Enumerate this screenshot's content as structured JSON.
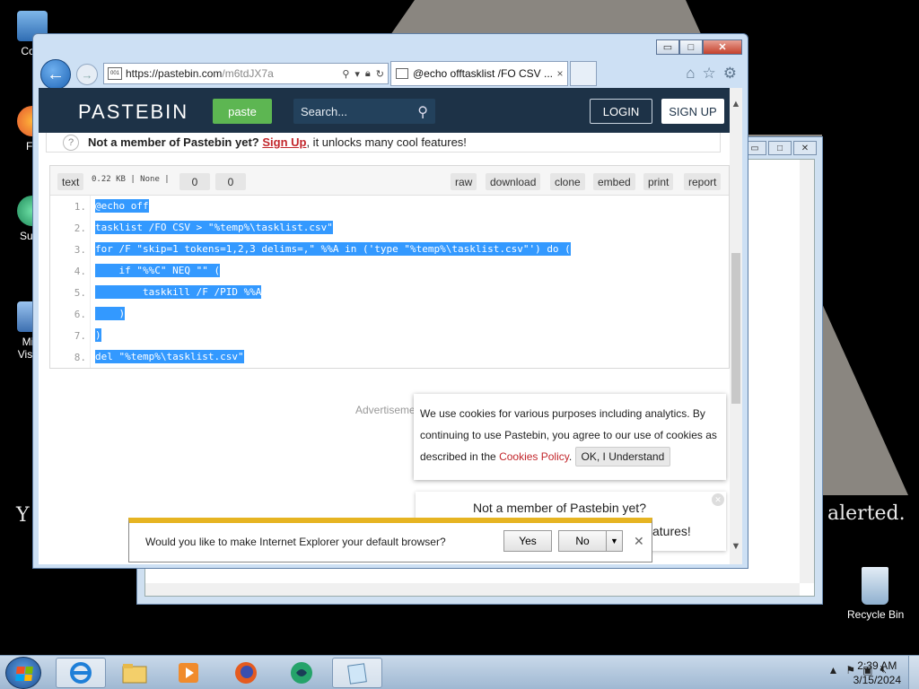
{
  "desktop": {
    "icons": [
      {
        "label": "Com",
        "icon": "computer-icon"
      },
      {
        "label": "Fir",
        "icon": "firefox-icon"
      },
      {
        "label": "Supe",
        "icon": "app-icon"
      },
      {
        "label": "Micr",
        "icon": "visual-studio-icon"
      },
      {
        "label": "Visual",
        "icon": "visual-studio-icon"
      },
      {
        "label": "Recycle Bin",
        "icon": "recycle-bin-icon"
      }
    ],
    "wallpaper_text_left": "Y",
    "wallpaper_text_right": "alerted."
  },
  "browser": {
    "url_host": "https://pastebin.com",
    "url_path": "/m6tdJX7a",
    "tab_title": "@echo offtasklist /FO CSV ...",
    "tab_close": "×",
    "back_glyph": "←",
    "forward_glyph": "→",
    "min_glyph": "▭",
    "max_glyph": "□",
    "close_glyph": "✕"
  },
  "pastebin": {
    "logo": "PASTEBIN",
    "paste_button": "paste",
    "search_placeholder": "Search...",
    "login": "LOGIN",
    "signup": "SIGN UP",
    "member_prefix": "Not a member of Pastebin yet?",
    "member_link": "Sign Up",
    "member_suffix": ", it unlocks many cool features!",
    "toolbar": {
      "syntax": "text",
      "meta": "0.22 KB | None |",
      "count1": "0",
      "count2": "0",
      "raw": "raw",
      "download": "download",
      "clone": "clone",
      "embed": "embed",
      "print": "print",
      "report": "report"
    },
    "code_lines": [
      {
        "n": "1.",
        "text": "@echo off"
      },
      {
        "n": "2.",
        "text": "tasklist /FO CSV > \"%temp%\\tasklist.csv\""
      },
      {
        "n": "3.",
        "text": "for /F \"skip=1 tokens=1,2,3 delims=,\" %%A in ('type \"%temp%\\tasklist.csv\"') do ("
      },
      {
        "n": "4.",
        "text": "    if \"%%C\" NEQ \"\" ("
      },
      {
        "n": "5.",
        "text": "        taskkill /F /PID %%A"
      },
      {
        "n": "6.",
        "text": "    )"
      },
      {
        "n": "7.",
        "text": ")"
      },
      {
        "n": "8.",
        "text": "del \"%temp%\\tasklist.csv\""
      }
    ],
    "ad_label": "Advertiseme",
    "cookie_text_1": "We use cookies for various purposes including analytics. By continuing to use Pastebin, you agree to our use of cookies as described in the ",
    "cookie_link": "Cookies Policy",
    "cookie_text_2": ". ",
    "cookie_ok": "OK, I Understand",
    "member2_title": "Not a member of Pastebin yet?",
    "member2_tail": "atures!"
  },
  "ie_notification": {
    "message": "Would you like to make Internet Explorer your default browser?",
    "yes": "Yes",
    "no": "No"
  },
  "taskbar": {
    "time": "2:39 AM",
    "date": "3/15/2024",
    "apps": [
      "internet-explorer-icon",
      "file-explorer-icon",
      "media-player-icon",
      "firefox-icon",
      "app-icon",
      "notepad-icon"
    ]
  }
}
